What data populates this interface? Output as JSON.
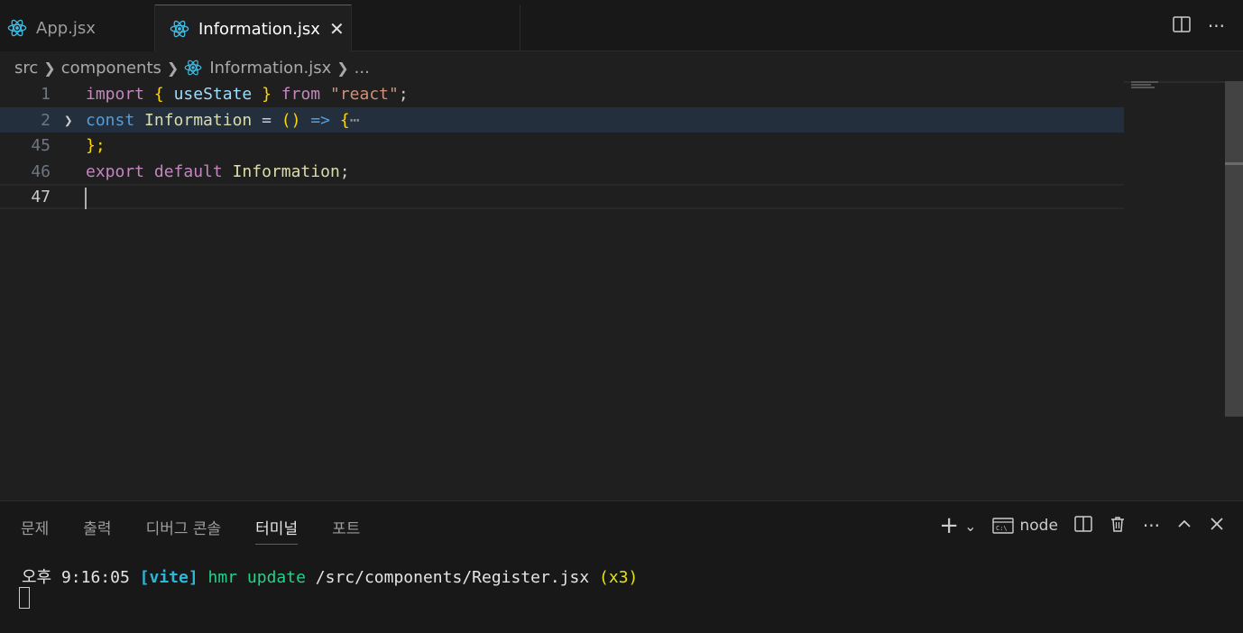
{
  "tabs": [
    {
      "label": "App.jsx",
      "icon": "react-icon",
      "active": false
    },
    {
      "label": "Information.jsx",
      "icon": "react-icon",
      "active": true,
      "close": "✕"
    }
  ],
  "tab_actions": {
    "split": "split-editor-icon",
    "more": "···"
  },
  "breadcrumb": {
    "items": [
      "src",
      "components",
      "Information.jsx",
      "..."
    ]
  },
  "editor": {
    "lines": [
      {
        "num": "1"
      },
      {
        "num": "2"
      },
      {
        "num": "45"
      },
      {
        "num": "46"
      },
      {
        "num": "47"
      }
    ],
    "code": {
      "l1": {
        "import": "import",
        "open": "{",
        "useState": "useState",
        "close": "}",
        "from": "from",
        "str": "\"react\"",
        "semi": ";"
      },
      "l2": {
        "const": "const",
        "name": "Information",
        "eq": "=",
        "parens": "()",
        "arrow": "=>",
        "brace": "{",
        "folded": "⋯"
      },
      "l45": {
        "text": "};"
      },
      "l46": {
        "export": "export",
        "default": "default",
        "name": "Information",
        "semi": ";"
      }
    }
  },
  "panel": {
    "tabs": [
      "문제",
      "출력",
      "디버그 콘솔",
      "터미널",
      "포트"
    ],
    "active_tab": "터미널",
    "actions": {
      "add": "+",
      "dropdown": "⌄",
      "terminal_name": "node",
      "more": "···"
    },
    "terminal": {
      "time": "오후 9:16:05",
      "vite": "[vite]",
      "hmr": "hmr update",
      "path": "/src/components/Register.jsx",
      "count": "(x3)"
    }
  },
  "colors": {
    "accent": "#0078d4",
    "background": "#1f1f1f"
  }
}
